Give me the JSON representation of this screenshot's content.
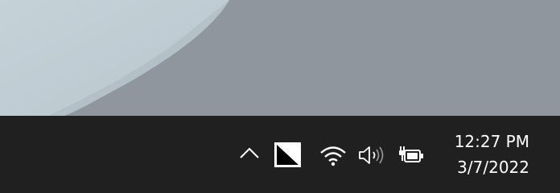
{
  "taskbar": {
    "tray": {
      "icons": {
        "overflow": "chevron-up-icon",
        "contrast": "contrast-icon",
        "wifi": "wifi-icon",
        "volume": "speaker-icon",
        "battery": "battery-charging-icon"
      }
    },
    "clock": {
      "time": "12:27 PM",
      "date": "3/7/2022"
    }
  },
  "colors": {
    "taskbar_bg": "#202020",
    "text": "#ffffff",
    "wallpaper_light": "#c9d5db",
    "wallpaper_dark": "#8f969d"
  }
}
